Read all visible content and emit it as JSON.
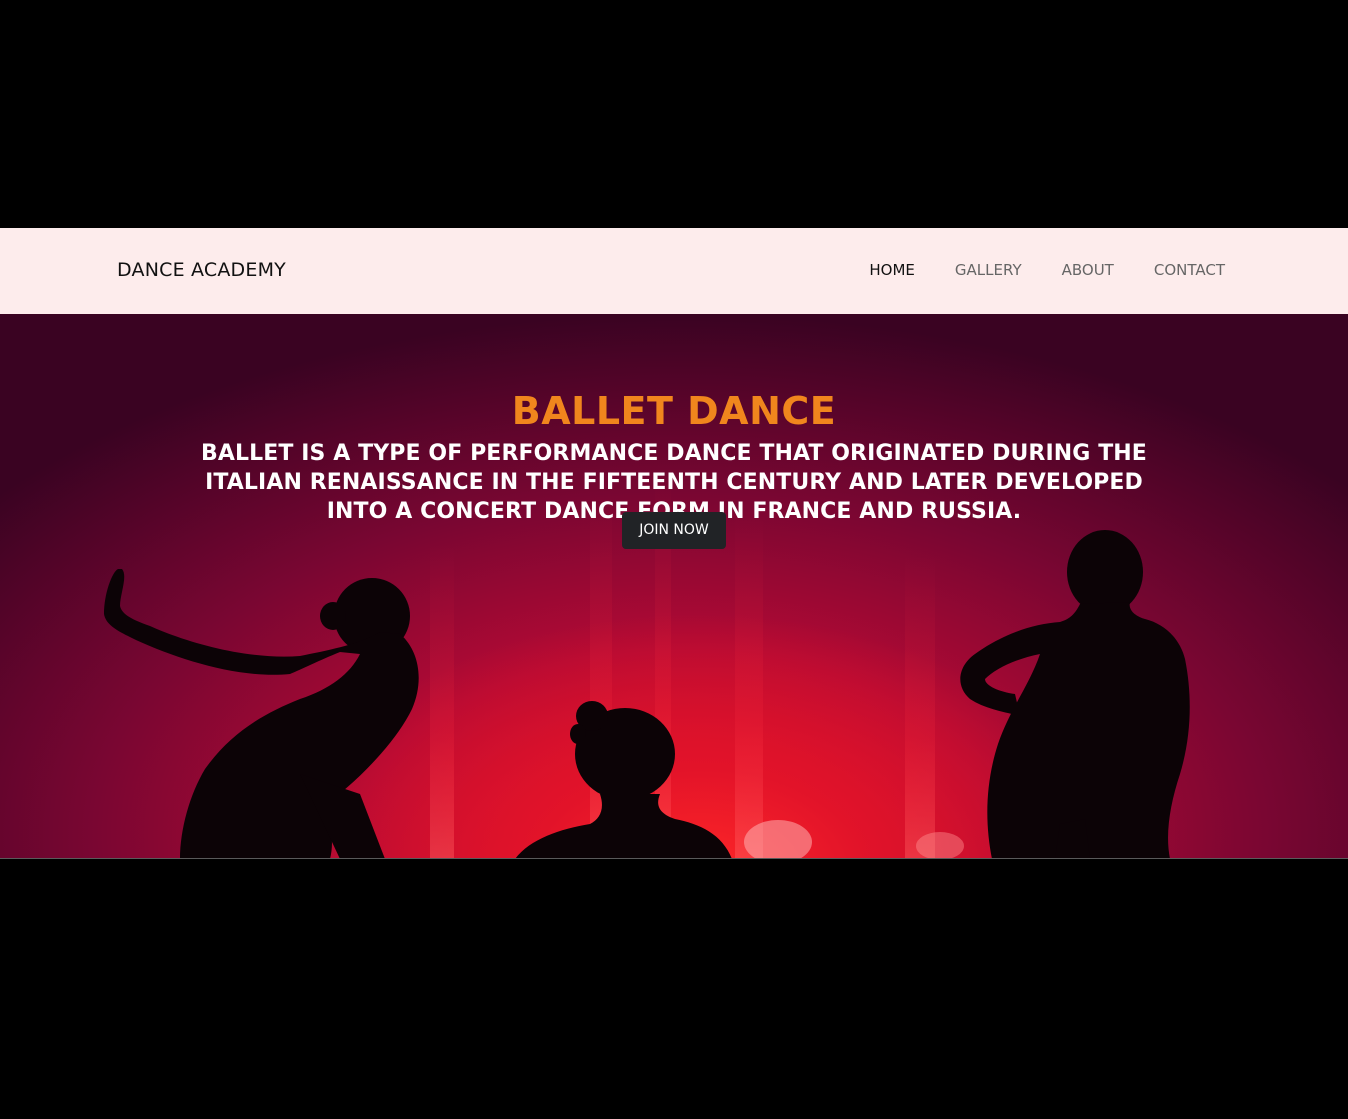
{
  "navbar": {
    "brand": "DANCE ACADEMY",
    "links": [
      {
        "label": "HOME",
        "active": true
      },
      {
        "label": "GALLERY",
        "active": false
      },
      {
        "label": "ABOUT",
        "active": false
      },
      {
        "label": "CONTACT",
        "active": false
      }
    ],
    "background_color": "#fdecec"
  },
  "hero": {
    "title": "BALLET DANCE",
    "description": "BALLET IS A TYPE OF PERFORMANCE DANCE THAT ORIGINATED DURING THE ITALIAN RENAISSANCE IN THE FIFTEENTH CENTURY AND LATER DEVELOPED INTO A CONCERT DANCE FORM IN FRANCE AND RUSSIA.",
    "button_label": "JOIN NOW",
    "title_color": "#f0861d",
    "image": "three-dancer-silhouettes-on-red-stage"
  }
}
